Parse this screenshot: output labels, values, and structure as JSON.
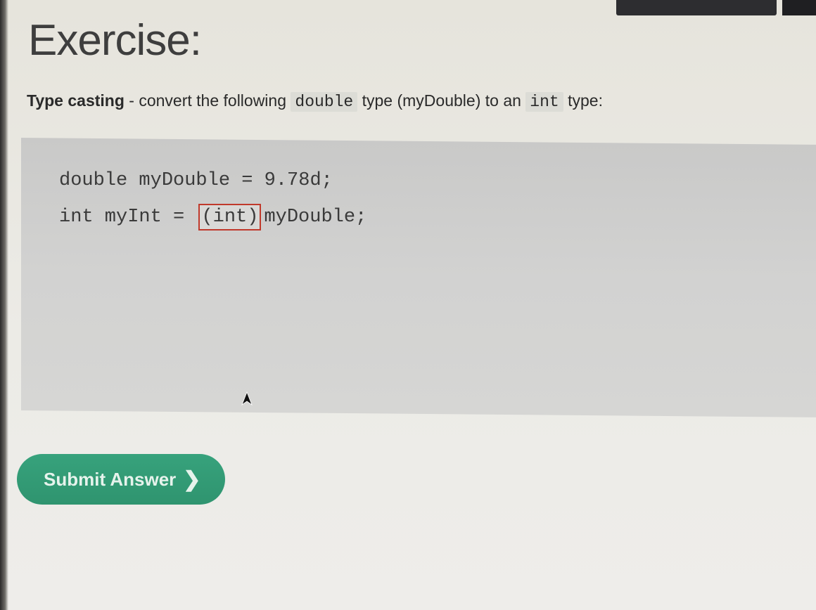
{
  "header": {
    "title": "Exercise:"
  },
  "instruction": {
    "bold_lead": "Type casting",
    "text_1": " - convert the following ",
    "code_1": "double",
    "text_2": " type (myDouble) to an ",
    "code_2": "int",
    "text_3": " type:"
  },
  "code": {
    "line1": "double myDouble = 9.78d;",
    "line2_prefix": "int myInt = ",
    "answer_value": "(int)",
    "line2_suffix": "myDouble;"
  },
  "submit": {
    "label": "Submit Answer",
    "icon": "chevron-right-icon"
  },
  "colors": {
    "accent": "#2f946f",
    "answer_border": "#c0392b"
  }
}
